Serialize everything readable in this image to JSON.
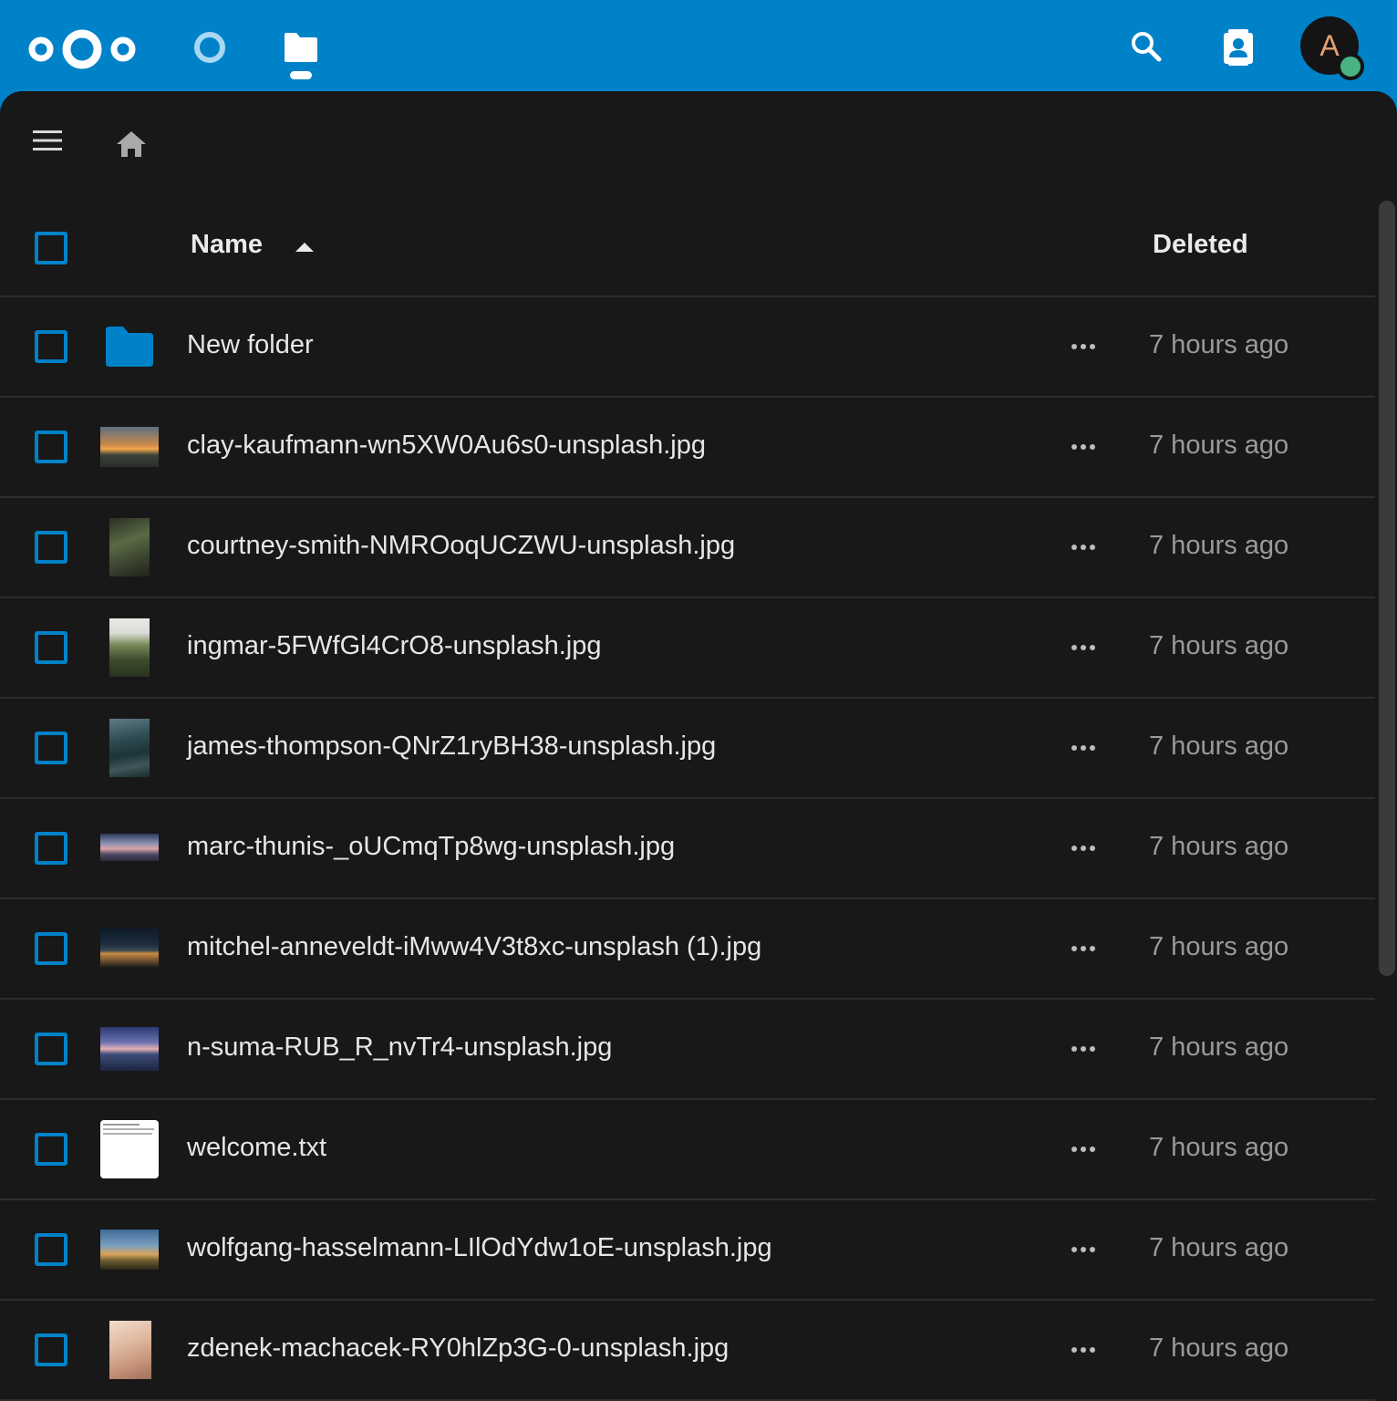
{
  "header": {
    "logo": "nextcloud-logo",
    "apps": [
      {
        "name": "dashboard",
        "icon": "dashboard-circle-icon",
        "active": false
      },
      {
        "name": "files",
        "icon": "folder-icon",
        "active": true
      }
    ],
    "search_icon": "search-icon",
    "contacts_icon": "contacts-icon",
    "avatar_letter": "A",
    "status": "online"
  },
  "toolbar": {
    "menu_icon": "hamburger-icon",
    "home_icon": "home-icon"
  },
  "table": {
    "columns": {
      "name": "Name",
      "deleted": "Deleted"
    },
    "sort": "ascending",
    "rows": [
      {
        "name": "New folder",
        "type": "folder",
        "deleted": "7 hours ago"
      },
      {
        "name": "clay-kaufmann-wn5XW0Au6s0-unsplash.jpg",
        "type": "image",
        "deleted": "7 hours ago"
      },
      {
        "name": "courtney-smith-NMROoqUCZWU-unsplash.jpg",
        "type": "image",
        "deleted": "7 hours ago"
      },
      {
        "name": "ingmar-5FWfGl4CrO8-unsplash.jpg",
        "type": "image",
        "deleted": "7 hours ago"
      },
      {
        "name": "james-thompson-QNrZ1ryBH38-unsplash.jpg",
        "type": "image",
        "deleted": "7 hours ago"
      },
      {
        "name": "marc-thunis-_oUCmqTp8wg-unsplash.jpg",
        "type": "image",
        "deleted": "7 hours ago"
      },
      {
        "name": "mitchel-anneveldt-iMww4V3t8xc-unsplash (1).jpg",
        "type": "image",
        "deleted": "7 hours ago"
      },
      {
        "name": "n-suma-RUB_R_nvTr4-unsplash.jpg",
        "type": "image",
        "deleted": "7 hours ago"
      },
      {
        "name": "welcome.txt",
        "type": "text",
        "deleted": "7 hours ago"
      },
      {
        "name": "wolfgang-hasselmann-LIlOdYdw1oE-unsplash.jpg",
        "type": "image",
        "deleted": "7 hours ago"
      },
      {
        "name": "zdenek-machacek-RY0hlZp3G-0-unsplash.jpg",
        "type": "image",
        "deleted": "7 hours ago"
      }
    ]
  },
  "colors": {
    "brand": "#0082c9",
    "background": "#181818",
    "online": "#49b382"
  }
}
